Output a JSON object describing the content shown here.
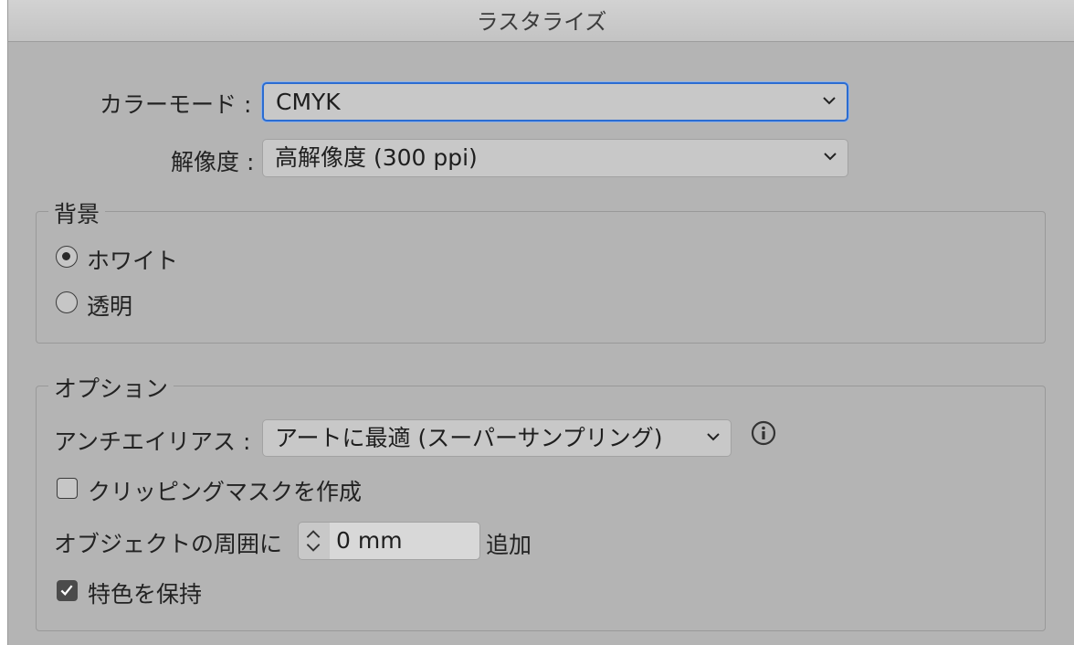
{
  "window": {
    "title": "ラスタライズ"
  },
  "color_mode": {
    "label": "カラーモード :",
    "value": "CMYK",
    "icon": "chevron-down-icon"
  },
  "resolution": {
    "label": "解像度 :",
    "value": "高解像度 (300 ppi)",
    "icon": "chevron-down-icon"
  },
  "background": {
    "legend": "背景",
    "options": [
      {
        "label": "ホワイト",
        "selected": true
      },
      {
        "label": "透明",
        "selected": false
      }
    ]
  },
  "options": {
    "legend": "オプション",
    "antialias": {
      "label": "アンチエイリアス :",
      "value": "アートに最適 (スーパーサンプリング)",
      "info_icon": "info-icon"
    },
    "clipping_mask": {
      "label": "クリッピングマスクを作成",
      "checked": false
    },
    "padding": {
      "prefix": "オブジェクトの周囲に",
      "value": "0 mm",
      "suffix": "追加"
    },
    "preserve_spot": {
      "label": "特色を保持",
      "checked": true
    }
  },
  "colors": {
    "focus": "#2b6cd1",
    "dialog_bg": "#b4b4b4"
  }
}
